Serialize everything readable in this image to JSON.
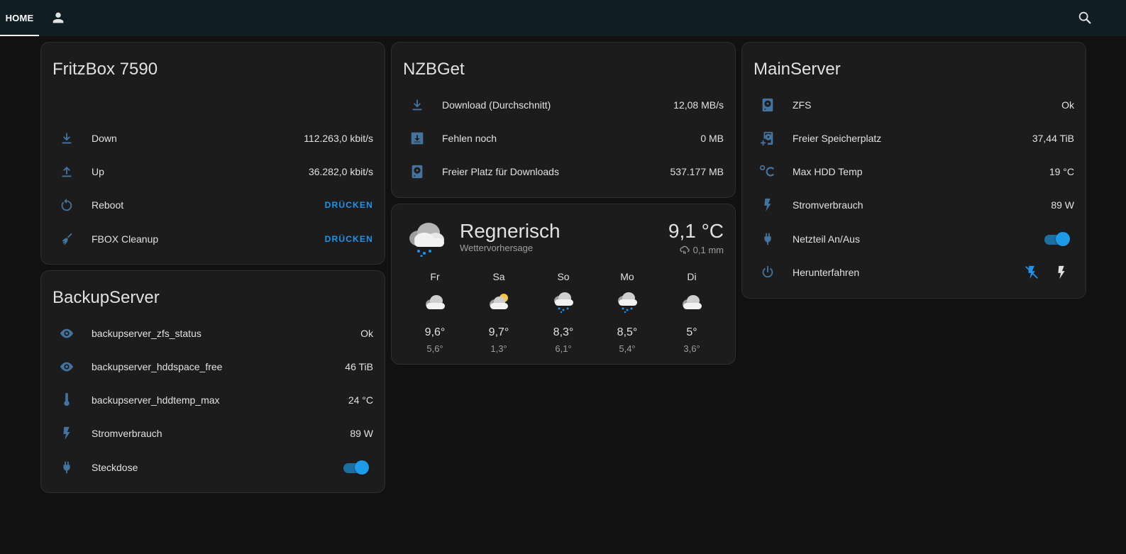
{
  "header": {
    "home_tab": "HOME"
  },
  "fritzbox": {
    "title": "FritzBox 7590",
    "rows": [
      {
        "label": "Down",
        "value": "112.263,0 kbit/s"
      },
      {
        "label": "Up",
        "value": "36.282,0 kbit/s"
      },
      {
        "label": "Reboot",
        "action": "DRÜCKEN"
      },
      {
        "label": "FBOX Cleanup",
        "action": "DRÜCKEN"
      }
    ]
  },
  "backup": {
    "title": "BackupServer",
    "rows": [
      {
        "label": "backupserver_zfs_status",
        "value": "Ok"
      },
      {
        "label": "backupserver_hddspace_free",
        "value": "46 TiB"
      },
      {
        "label": "backupserver_hddtemp_max",
        "value": "24 °C"
      },
      {
        "label": "Stromverbrauch",
        "value": "89 W"
      },
      {
        "label": "Steckdose",
        "toggle_on": true
      }
    ]
  },
  "nzbget": {
    "title": "NZBGet",
    "rows": [
      {
        "label": "Download (Durchschnitt)",
        "value": "12,08 MB/s"
      },
      {
        "label": "Fehlen noch",
        "value": "0 MB"
      },
      {
        "label": "Freier Platz für Downloads",
        "value": "537.177 MB"
      }
    ]
  },
  "weather": {
    "condition": "Regnerisch",
    "subtitle": "Wettervorhersage",
    "temperature": "9,1 °C",
    "precipitation": "0,1 mm",
    "forecast": [
      {
        "day": "Fr",
        "hi": "9,6°",
        "lo": "5,6°",
        "icon": "cloudy-icon"
      },
      {
        "day": "Sa",
        "hi": "9,7°",
        "lo": "1,3°",
        "icon": "partly-cloudy-icon"
      },
      {
        "day": "So",
        "hi": "8,3°",
        "lo": "6,1°",
        "icon": "rainy-icon"
      },
      {
        "day": "Mo",
        "hi": "8,5°",
        "lo": "5,4°",
        "icon": "rainy-icon"
      },
      {
        "day": "Di",
        "hi": "5°",
        "lo": "3,6°",
        "icon": "cloudy-icon"
      }
    ]
  },
  "mainserver": {
    "title": "MainServer",
    "rows": [
      {
        "label": "ZFS",
        "value": "Ok"
      },
      {
        "label": "Freier Speicherplatz",
        "value": "37,44 TiB"
      },
      {
        "label": "Max HDD Temp",
        "value": "19 °C"
      },
      {
        "label": "Stromverbrauch",
        "value": "89 W"
      },
      {
        "label": "Netzteil An/Aus",
        "toggle_on": true
      },
      {
        "label": "Herunterfahren"
      }
    ]
  },
  "colors": {
    "accent": "#1e95e8",
    "icon": "#44739e",
    "card": "#1c1c1c",
    "background": "#111111",
    "topbar": "#101e24"
  }
}
